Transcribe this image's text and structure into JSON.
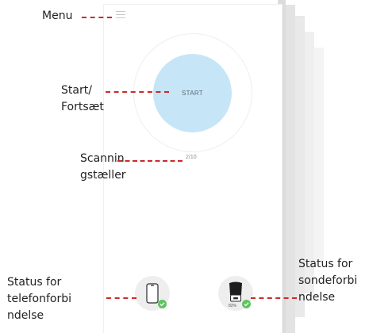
{
  "app": {
    "start_button_label": "START",
    "scan_counter": "2/10",
    "probe_battery": "82%"
  },
  "annotations": {
    "menu": "Menu",
    "start": "Start/\nFortsæt",
    "scan_counter": "Scannin\ngstæller",
    "phone_status": "Status for\ntelefonforbi\nndelse",
    "probe_status": "Status for\nsondeforbi\nndelse"
  },
  "icons": {
    "menu": "hamburger-icon",
    "phone": "smartphone-icon",
    "probe": "ultrasound-probe-icon",
    "status_ok": "checkmark-icon"
  },
  "colors": {
    "start_button": "#c6e6f8",
    "status_ok": "#5cc55f",
    "annotation_line": "#cc2a2a"
  }
}
